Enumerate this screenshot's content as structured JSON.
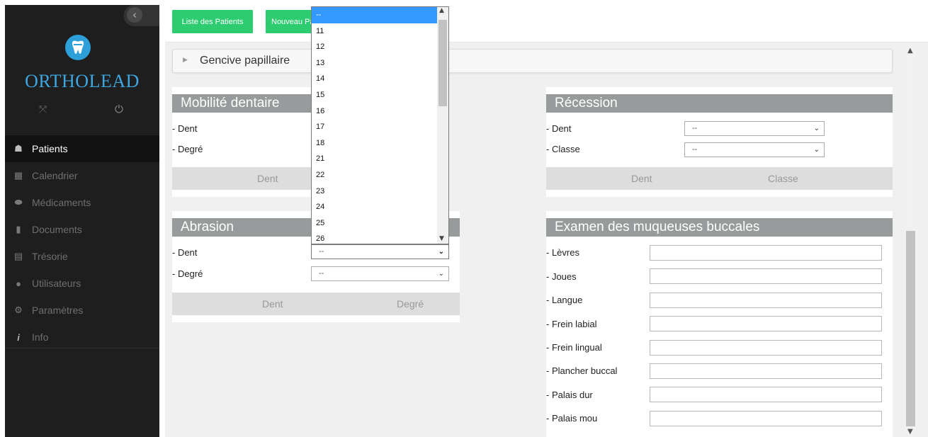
{
  "brand": {
    "name": "ORTHOLEAD"
  },
  "sidebar": {
    "items": [
      {
        "label": "Patients",
        "icon": "users-icon",
        "active": true
      },
      {
        "label": "Calendrier",
        "icon": "calendar-icon",
        "active": false
      },
      {
        "label": "Médicaments",
        "icon": "pill-icon",
        "active": false
      },
      {
        "label": "Documents",
        "icon": "document-icon",
        "active": false
      },
      {
        "label": "Trésorie",
        "icon": "cash-register-icon",
        "active": false
      },
      {
        "label": "Utilisateurs",
        "icon": "user-icon",
        "active": false
      },
      {
        "label": "Paramètres",
        "icon": "gears-icon",
        "active": false
      },
      {
        "label": "Info",
        "icon": "info-icon",
        "active": false
      }
    ]
  },
  "topbar": {
    "liste_label": "Liste des Patients",
    "nouveau_label": "Nouveau Patient"
  },
  "gencive": {
    "title": "Gencive papillaire"
  },
  "mobilite": {
    "title": "Mobilité dentaire",
    "dent_label": "- Dent",
    "degre_label": "- Degré",
    "col_dent": "Dent"
  },
  "recession": {
    "title": "Récession",
    "dent_label": "- Dent",
    "classe_label": "- Classe",
    "dent_value": "--",
    "classe_value": "--",
    "col_dent": "Dent",
    "col_classe": "Classe"
  },
  "abrasion": {
    "title": "Abrasion",
    "dent_label": "- Dent",
    "degre_label": "- Degré",
    "dent_value": "--",
    "degre_value": "--",
    "col_dent": "Dent",
    "col_degre": "Degré"
  },
  "examen": {
    "title": "Examen des muqueuses buccales",
    "fields": [
      {
        "label": "- Lèvres",
        "value": ""
      },
      {
        "label": "- Joues",
        "value": ""
      },
      {
        "label": "- Langue",
        "value": ""
      },
      {
        "label": "- Frein labial",
        "value": ""
      },
      {
        "label": "- Frein lingual",
        "value": ""
      },
      {
        "label": "- Plancher buccal",
        "value": ""
      },
      {
        "label": "- Palais dur",
        "value": ""
      },
      {
        "label": "- Palais mou",
        "value": ""
      }
    ]
  },
  "dropdown": {
    "options": [
      "--",
      "11",
      "12",
      "13",
      "14",
      "15",
      "16",
      "17",
      "18",
      "21",
      "22",
      "23",
      "24",
      "25",
      "26"
    ],
    "selected": "--"
  },
  "colors": {
    "accent_green": "#2ecc71",
    "brand_blue": "#3da6e0",
    "panel_head": "#979b9b",
    "sidebar_bg": "#1e1e1e"
  }
}
